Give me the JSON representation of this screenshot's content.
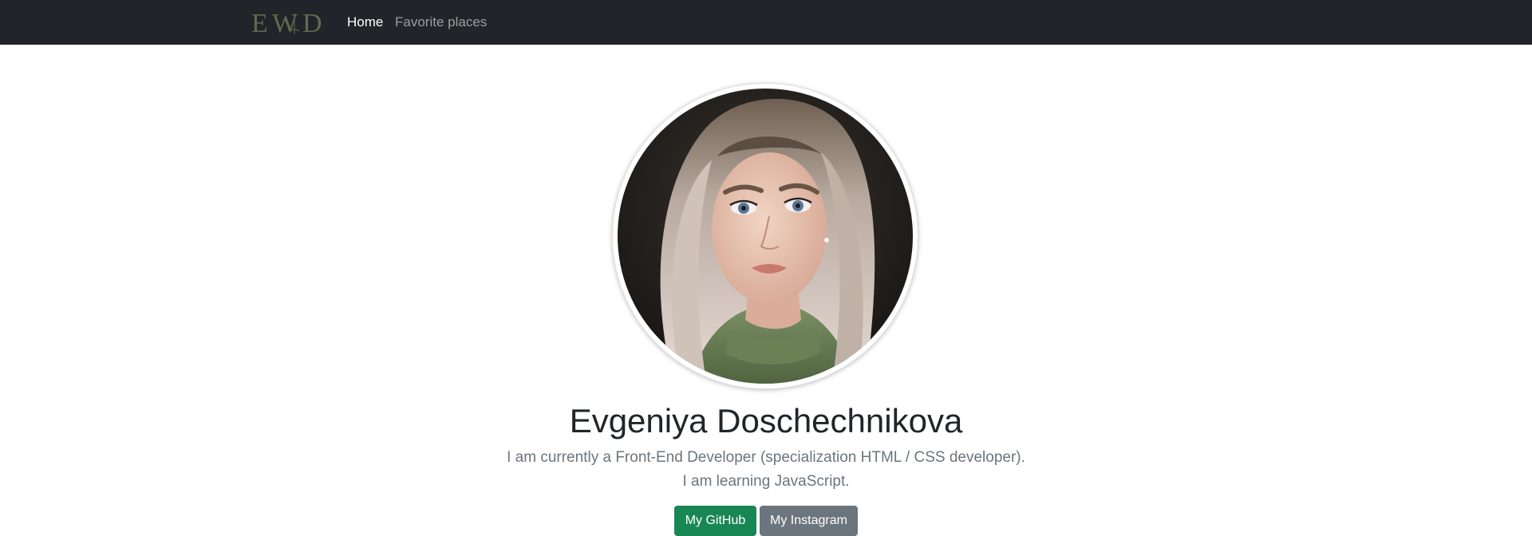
{
  "navbar": {
    "brand_logo_text": "EWD",
    "links": [
      {
        "label": "Home",
        "active": true
      },
      {
        "label": "Favorite places",
        "active": false
      }
    ],
    "background_color": "#212529"
  },
  "profile": {
    "avatar_icon": "profile-photo",
    "name": "Evgeniya Doschechnikova",
    "lead_line_1": "I am currently a Front-End Developer (specialization HTML / CSS developer).",
    "lead_line_2": "I am learning JavaScript."
  },
  "buttons": {
    "github_label": "My GitHub",
    "instagram_label": "My Instagram",
    "github_color": "#198754",
    "instagram_color": "#6c757d"
  }
}
